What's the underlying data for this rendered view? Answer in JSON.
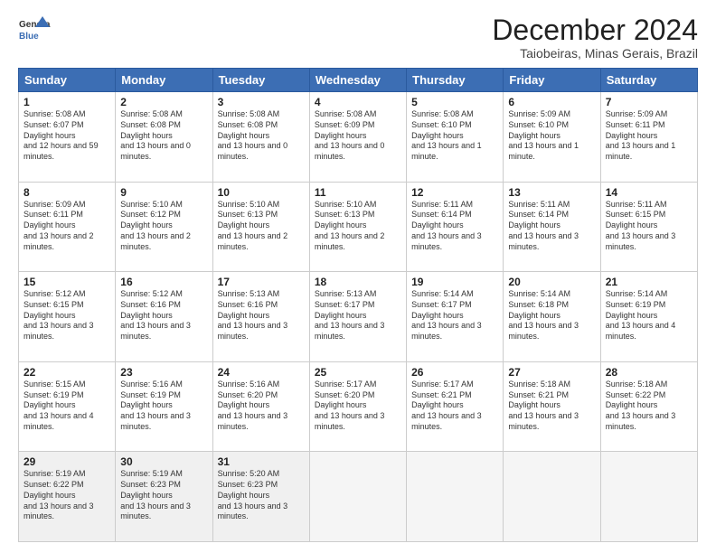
{
  "logo": {
    "line1": "General",
    "line2": "Blue"
  },
  "title": "December 2024",
  "subtitle": "Taiobeiras, Minas Gerais, Brazil",
  "days_of_week": [
    "Sunday",
    "Monday",
    "Tuesday",
    "Wednesday",
    "Thursday",
    "Friday",
    "Saturday"
  ],
  "weeks": [
    [
      {
        "day": "1",
        "sunrise": "5:08 AM",
        "sunset": "6:07 PM",
        "daylight": "12 hours and 59 minutes."
      },
      {
        "day": "2",
        "sunrise": "5:08 AM",
        "sunset": "6:08 PM",
        "daylight": "13 hours and 0 minutes."
      },
      {
        "day": "3",
        "sunrise": "5:08 AM",
        "sunset": "6:08 PM",
        "daylight": "13 hours and 0 minutes."
      },
      {
        "day": "4",
        "sunrise": "5:08 AM",
        "sunset": "6:09 PM",
        "daylight": "13 hours and 0 minutes."
      },
      {
        "day": "5",
        "sunrise": "5:08 AM",
        "sunset": "6:10 PM",
        "daylight": "13 hours and 1 minute."
      },
      {
        "day": "6",
        "sunrise": "5:09 AM",
        "sunset": "6:10 PM",
        "daylight": "13 hours and 1 minute."
      },
      {
        "day": "7",
        "sunrise": "5:09 AM",
        "sunset": "6:11 PM",
        "daylight": "13 hours and 1 minute."
      }
    ],
    [
      {
        "day": "8",
        "sunrise": "5:09 AM",
        "sunset": "6:11 PM",
        "daylight": "13 hours and 2 minutes."
      },
      {
        "day": "9",
        "sunrise": "5:10 AM",
        "sunset": "6:12 PM",
        "daylight": "13 hours and 2 minutes."
      },
      {
        "day": "10",
        "sunrise": "5:10 AM",
        "sunset": "6:13 PM",
        "daylight": "13 hours and 2 minutes."
      },
      {
        "day": "11",
        "sunrise": "5:10 AM",
        "sunset": "6:13 PM",
        "daylight": "13 hours and 2 minutes."
      },
      {
        "day": "12",
        "sunrise": "5:11 AM",
        "sunset": "6:14 PM",
        "daylight": "13 hours and 3 minutes."
      },
      {
        "day": "13",
        "sunrise": "5:11 AM",
        "sunset": "6:14 PM",
        "daylight": "13 hours and 3 minutes."
      },
      {
        "day": "14",
        "sunrise": "5:11 AM",
        "sunset": "6:15 PM",
        "daylight": "13 hours and 3 minutes."
      }
    ],
    [
      {
        "day": "15",
        "sunrise": "5:12 AM",
        "sunset": "6:15 PM",
        "daylight": "13 hours and 3 minutes."
      },
      {
        "day": "16",
        "sunrise": "5:12 AM",
        "sunset": "6:16 PM",
        "daylight": "13 hours and 3 minutes."
      },
      {
        "day": "17",
        "sunrise": "5:13 AM",
        "sunset": "6:16 PM",
        "daylight": "13 hours and 3 minutes."
      },
      {
        "day": "18",
        "sunrise": "5:13 AM",
        "sunset": "6:17 PM",
        "daylight": "13 hours and 3 minutes."
      },
      {
        "day": "19",
        "sunrise": "5:14 AM",
        "sunset": "6:17 PM",
        "daylight": "13 hours and 3 minutes."
      },
      {
        "day": "20",
        "sunrise": "5:14 AM",
        "sunset": "6:18 PM",
        "daylight": "13 hours and 3 minutes."
      },
      {
        "day": "21",
        "sunrise": "5:14 AM",
        "sunset": "6:19 PM",
        "daylight": "13 hours and 4 minutes."
      }
    ],
    [
      {
        "day": "22",
        "sunrise": "5:15 AM",
        "sunset": "6:19 PM",
        "daylight": "13 hours and 4 minutes."
      },
      {
        "day": "23",
        "sunrise": "5:16 AM",
        "sunset": "6:19 PM",
        "daylight": "13 hours and 3 minutes."
      },
      {
        "day": "24",
        "sunrise": "5:16 AM",
        "sunset": "6:20 PM",
        "daylight": "13 hours and 3 minutes."
      },
      {
        "day": "25",
        "sunrise": "5:17 AM",
        "sunset": "6:20 PM",
        "daylight": "13 hours and 3 minutes."
      },
      {
        "day": "26",
        "sunrise": "5:17 AM",
        "sunset": "6:21 PM",
        "daylight": "13 hours and 3 minutes."
      },
      {
        "day": "27",
        "sunrise": "5:18 AM",
        "sunset": "6:21 PM",
        "daylight": "13 hours and 3 minutes."
      },
      {
        "day": "28",
        "sunrise": "5:18 AM",
        "sunset": "6:22 PM",
        "daylight": "13 hours and 3 minutes."
      }
    ],
    [
      {
        "day": "29",
        "sunrise": "5:19 AM",
        "sunset": "6:22 PM",
        "daylight": "13 hours and 3 minutes."
      },
      {
        "day": "30",
        "sunrise": "5:19 AM",
        "sunset": "6:23 PM",
        "daylight": "13 hours and 3 minutes."
      },
      {
        "day": "31",
        "sunrise": "5:20 AM",
        "sunset": "6:23 PM",
        "daylight": "13 hours and 3 minutes."
      },
      null,
      null,
      null,
      null
    ]
  ]
}
